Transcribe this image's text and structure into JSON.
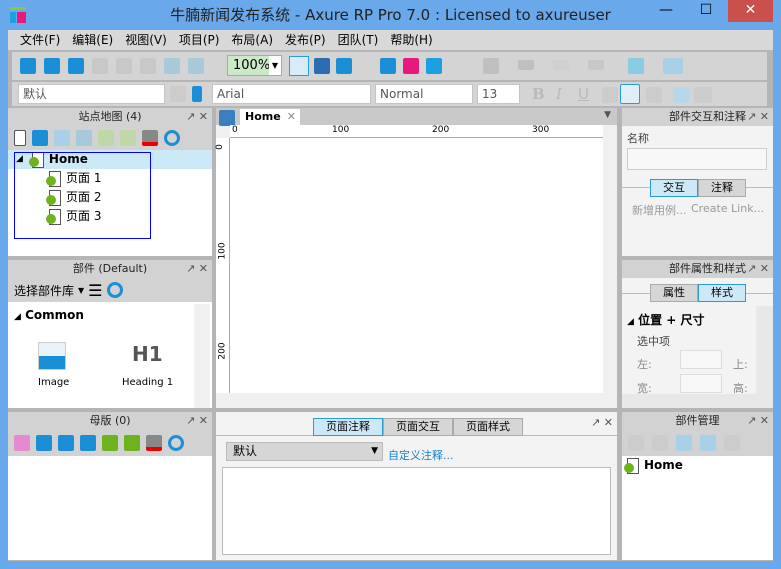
{
  "window": {
    "title": "牛腩新闻发布系统 - Axure RP Pro 7.0 : Licensed to axureuser",
    "minimize": "—",
    "maximize": "☐",
    "close": "✕"
  },
  "menu": [
    "文件(F)",
    "编辑(E)",
    "视图(V)",
    "项目(P)",
    "布局(A)",
    "发布(P)",
    "团队(T)",
    "帮助(H)"
  ],
  "toolbar": {
    "zoom": "100%",
    "style": "默认",
    "font": "Arial",
    "weight": "Normal",
    "size": "13",
    "bold": "B",
    "italic": "I",
    "underline": "U"
  },
  "sitemap": {
    "title": "站点地图 (4)",
    "root": "Home",
    "pages": [
      "页面 1",
      "页面 2",
      "页面 3"
    ]
  },
  "widgets": {
    "title": "部件 (Default)",
    "library": "选择部件库",
    "section": "Common",
    "items": [
      "Image",
      "Heading 1"
    ],
    "heading_glyph": "H1"
  },
  "masters": {
    "title": "母版 (0)"
  },
  "canvas": {
    "tab": "Home",
    "ruler_top": [
      "0",
      "100",
      "200",
      "300"
    ],
    "ruler_left": [
      "0",
      "100",
      "200"
    ]
  },
  "notes": {
    "tabs": [
      "页面注释",
      "页面交互",
      "页面样式"
    ],
    "active": 0,
    "select": "默认",
    "custom_link": "自定义注释..."
  },
  "interactions": {
    "title": "部件交互和注释",
    "name_label": "名称",
    "tabs": [
      "交互",
      "注释"
    ],
    "active": 0,
    "add_case": "新增用例...",
    "create_link": "Create Link..."
  },
  "properties": {
    "title": "部件属性和样式",
    "tabs": [
      "属性",
      "样式"
    ],
    "active": 1,
    "section": "位置 + 尺寸",
    "selected": "选中项",
    "left": "左:",
    "top": "上:",
    "width": "宽:",
    "height": "高:"
  },
  "manager": {
    "title": "部件管理",
    "item": "Home"
  },
  "colors": {
    "accent": "#2a9ad8",
    "page_green": "#6db31e",
    "selection": "#cde8f7",
    "close_red": "#c9504c"
  }
}
